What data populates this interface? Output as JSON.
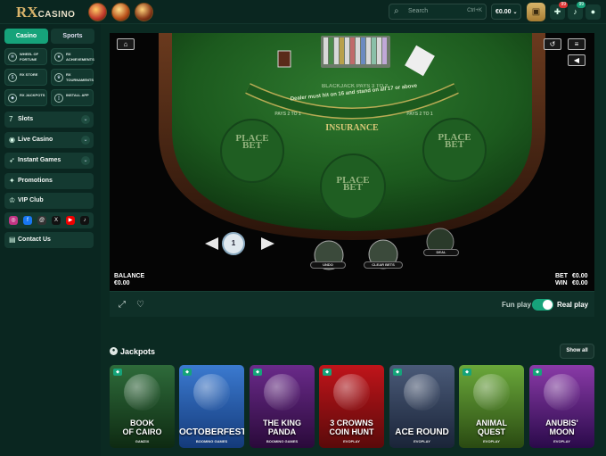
{
  "header": {
    "logo_main": "RX",
    "logo_sub": "CASINO",
    "search_placeholder": "Search",
    "search_shortcut": "Ctrl+K",
    "balance": "€0.00",
    "notif_count_1": "99",
    "notif_count_2": "99"
  },
  "sidebar": {
    "tab_casino": "Casino",
    "tab_sports": "Sports",
    "tiles": [
      "WHEEL OF FORTUNE",
      "RX ACHIEVEMENTS",
      "RX STORE",
      "RX TOURNAMENTS",
      "RX JACKPOTS",
      "INSTALL APP"
    ],
    "nav": [
      "Slots",
      "Live Casino",
      "Instant Games",
      "Promotions",
      "VIP Club",
      "Contact Us"
    ]
  },
  "game": {
    "place_bet_1": "PLACE\nBET",
    "place_bet_2": "PLACE\nBET",
    "place_bet_3": "PLACE\nBET",
    "rule_text": "Dealer must hit on 16 and stand on all 17 or above",
    "blackjack_pays": "BLACKJACK PAYS 3 TO 2",
    "pays_left": "PAYS 2 TO 1",
    "pays_right": "PAYS 2 TO 1",
    "insurance": "INSURANCE",
    "chip_value": "1",
    "undo": "UNDO",
    "clear_bets": "CLEAR BETS",
    "deal": "DEAL",
    "balance_label": "BALANCE",
    "balance_value": "€0.00",
    "bet_label": "BET",
    "bet_value": "€0.00",
    "win_label": "WIN",
    "win_value": "€0.00"
  },
  "controls": {
    "fun_play": "Fun play",
    "real_play": "Real play"
  },
  "jackpots": {
    "title": "Jackpots",
    "show_all": "Show all",
    "cards": [
      {
        "title": "BOOK\nOF CAIRO",
        "provider": "GAMZIX",
        "color1": "#2e6b3a",
        "color2": "#0e2a12"
      },
      {
        "title": "OCTOBERFEST",
        "provider": "BOOMING GAMES",
        "color1": "#3b7ad0",
        "color2": "#143a7a"
      },
      {
        "title": "THE KING\nPANDA",
        "provider": "BOOMING GAMES",
        "color1": "#6a2a8a",
        "color2": "#2a0a3a"
      },
      {
        "title": "3 CROWNS\nCOIN HUNT",
        "provider": "EVOPLAY",
        "color1": "#c0141a",
        "color2": "#5a0a0a"
      },
      {
        "title": "ACE ROUND",
        "provider": "EVOPLAY",
        "color1": "#4a5a78",
        "color2": "#1a2438"
      },
      {
        "title": "ANIMAL\nQUEST",
        "provider": "EVOPLAY",
        "color1": "#6aa83a",
        "color2": "#2a4a12"
      },
      {
        "title": "ANUBIS'\nMOON",
        "provider": "EVOPLAY",
        "color1": "#8a3aa8",
        "color2": "#2a0a4a"
      }
    ]
  }
}
